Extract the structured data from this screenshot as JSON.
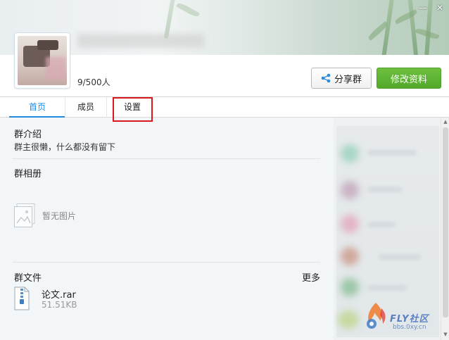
{
  "window": {
    "controls": [
      "—",
      "✕"
    ]
  },
  "header": {
    "member_count": "9/500人",
    "share_label": "分享群",
    "edit_label": "修改资料"
  },
  "tabs": [
    {
      "label": "首页",
      "active": true
    },
    {
      "label": "成员",
      "active": false
    },
    {
      "label": "设置",
      "active": false,
      "highlighted": true
    }
  ],
  "intro": {
    "title": "群介绍",
    "text": "群主很懒，什么都没有留下"
  },
  "album": {
    "title": "群相册",
    "empty_text": "暂无图片"
  },
  "files": {
    "title": "群文件",
    "more_label": "更多",
    "items": [
      {
        "name": "论文.rar",
        "size": "51.51KB"
      }
    ]
  },
  "watermark": {
    "title": "FLY社区",
    "sub": "bbs.0xy.cn"
  },
  "colors": {
    "accent_blue": "#1e8ae0",
    "edit_green": "#53a82b",
    "highlight_red": "#d8181e"
  }
}
